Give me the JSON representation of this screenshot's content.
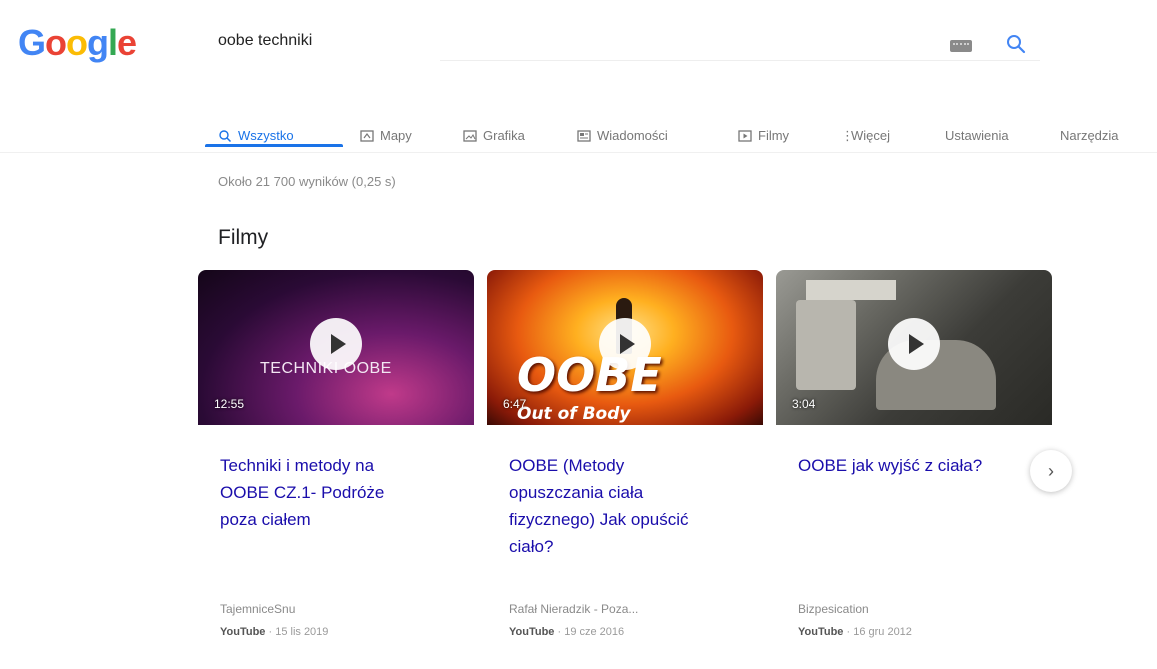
{
  "logo": {
    "letters": [
      "G",
      "o",
      "o",
      "g",
      "l",
      "e"
    ],
    "colors": [
      "#4285f4",
      "#ea4335",
      "#fbbc05",
      "#4285f4",
      "#34a853",
      "#ea4335"
    ]
  },
  "search": {
    "query": "oobe techniki"
  },
  "tabs": [
    {
      "label": "Wszystko",
      "icon": "search-icon",
      "active": true
    },
    {
      "label": "Mapy",
      "icon": "map-icon"
    },
    {
      "label": "Grafika",
      "icon": "image-icon"
    },
    {
      "label": "Wiadomości",
      "icon": "news-icon"
    },
    {
      "label": "Filmy",
      "icon": "video-icon"
    },
    {
      "label": "Więcej",
      "icon": "more-icon"
    },
    {
      "label": "Ustawienia"
    },
    {
      "label": "Narzędzia"
    }
  ],
  "results_stats": "Około 21 700 wyników (0,25 s)",
  "section_title": "Filmy",
  "videos": [
    {
      "title": "Techniki i metody na OOBE CZ.1- Podróże poza ciałem",
      "duration": "12:55",
      "thumb_text": "TECHNIKI OOBE",
      "channel": "TajemniceSnu",
      "source": "YouTube",
      "date": "15 lis 2019"
    },
    {
      "title": "OOBE (Metody opuszczania ciała fizycznego) Jak opuścić ciało?",
      "duration": "6:47",
      "thumb_text": "OOBE",
      "thumb_subtext": "Out of Body",
      "channel": "Rafał Nieradzik - Poza...",
      "source": "YouTube",
      "date": "19 cze 2016"
    },
    {
      "title": "OOBE jak wyjść z ciała?",
      "duration": "3:04",
      "channel": "Bizpesication",
      "source": "YouTube",
      "date": "16 gru 2012"
    }
  ],
  "next_button": "›"
}
